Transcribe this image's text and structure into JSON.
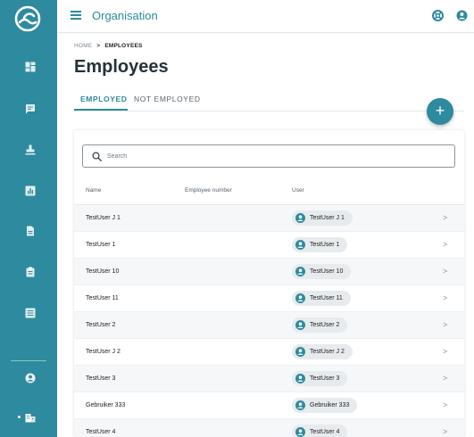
{
  "topbar": {
    "title": "Organisation"
  },
  "breadcrumb": {
    "home": "HOME",
    "separator": ">",
    "current": "EMPLOYEES"
  },
  "page": {
    "title": "Employees"
  },
  "tabs": [
    {
      "label": "EMPLOYED",
      "active": true
    },
    {
      "label": "NOT EMPLOYED",
      "active": false
    }
  ],
  "fab": {
    "label": "+"
  },
  "search": {
    "placeholder": "Search",
    "value": ""
  },
  "table": {
    "columns": [
      "Name",
      "Employee number",
      "User"
    ],
    "rows": [
      {
        "name": "TestUser J 1",
        "employee_number": "",
        "user": "TestUser J 1"
      },
      {
        "name": "TestUser 1",
        "employee_number": "",
        "user": "TestUser 1"
      },
      {
        "name": "TestUser 10",
        "employee_number": "",
        "user": "TestUser 10"
      },
      {
        "name": "TestUser 11",
        "employee_number": "",
        "user": "TestUser 11"
      },
      {
        "name": "TestUser 2",
        "employee_number": "",
        "user": "TestUser 2"
      },
      {
        "name": "TestUser J 2",
        "employee_number": "",
        "user": "TestUser J 2"
      },
      {
        "name": "TestUser 3",
        "employee_number": "",
        "user": "TestUser 3"
      },
      {
        "name": "Gebruiker 333",
        "employee_number": "",
        "user": "Gebruiker 333"
      },
      {
        "name": "TestUser 4",
        "employee_number": "",
        "user": "TestUser 4"
      }
    ]
  },
  "chevron": ">",
  "colors": {
    "accent": "#2e8a9e",
    "sidebar": "#2e8a9e",
    "chip": "#e7ebee"
  },
  "icons": {
    "logo": "wave-logo-icon",
    "sidebar": [
      "dashboard-icon",
      "chat-icon",
      "stamp-icon",
      "chart-icon",
      "document-icon",
      "clipboard-icon",
      "list-icon",
      "account-icon",
      "organisation-icon"
    ],
    "topbar": [
      "hamburger-icon",
      "support-icon",
      "account-icon"
    ]
  }
}
